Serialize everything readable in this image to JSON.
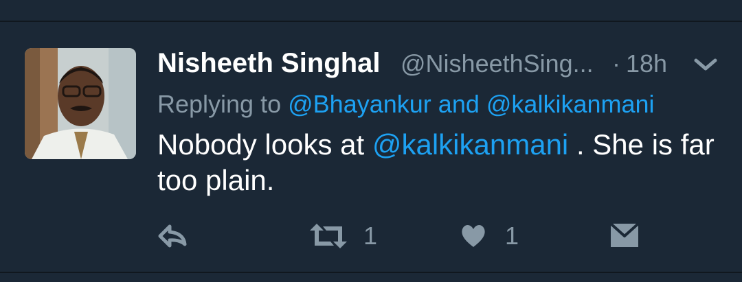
{
  "tweet": {
    "author_name": "Nisheeth Singhal",
    "author_handle": "@NisheethSing...",
    "separator": "·",
    "time": "18h",
    "replying_prefix": "Replying to",
    "replying_user_1": "@Bhayankur",
    "replying_and": "and",
    "replying_user_2": "@kalkikanmani",
    "text_part1": "Nobody looks at",
    "text_mention": "@kalkikanmani",
    "text_part2": ". She is far too plain.",
    "retweet_count": "1",
    "like_count": "1"
  },
  "colors": {
    "background": "#1b2836",
    "link": "#1da1f2",
    "muted": "#8899a6",
    "text": "#ffffff"
  },
  "icons": {
    "reply": "reply-arrow-icon",
    "retweet": "retweet-icon",
    "like": "heart-icon",
    "dm": "envelope-icon",
    "menu": "chevron-down-icon"
  }
}
